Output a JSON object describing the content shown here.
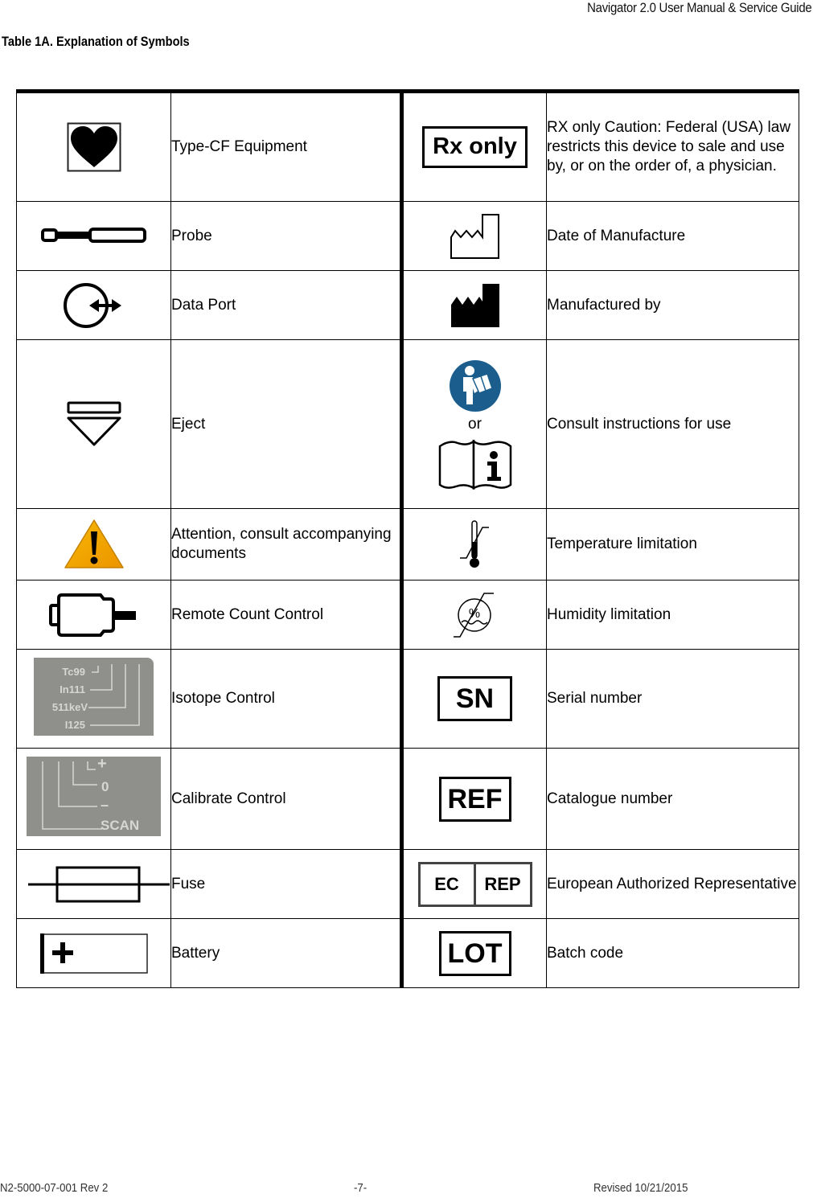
{
  "header": {
    "document_title": "Navigator 2.0 User Manual & Service Guide",
    "table_title": "Table 1A. Explanation of Symbols"
  },
  "rows": [
    {
      "left": {
        "icon": "type-cf-heart-icon",
        "label": "Type-CF Equipment"
      },
      "right": {
        "icon": "rx-only-icon",
        "icon_text": "Rx only",
        "label": "RX only Caution: Federal (USA) law restricts this device to sale and use by, or on the order of, a physician."
      }
    },
    {
      "left": {
        "icon": "probe-icon",
        "label": "Probe"
      },
      "right": {
        "icon": "date-of-manufacture-icon",
        "label": "Date of Manufacture"
      }
    },
    {
      "left": {
        "icon": "data-port-icon",
        "label": "Data Port"
      },
      "right": {
        "icon": "manufacturer-icon",
        "label": "Manufactured by"
      }
    },
    {
      "left": {
        "icon": "eject-icon",
        "label": "Eject"
      },
      "right": {
        "icon": "consult-instructions-icon",
        "or_text": "or",
        "label": "Consult instructions for use"
      }
    },
    {
      "left": {
        "icon": "warning-triangle-icon",
        "label": "Attention, consult accompanying documents"
      },
      "right": {
        "icon": "temperature-limit-icon",
        "label": "Temperature limitation"
      }
    },
    {
      "left": {
        "icon": "remote-count-control-icon",
        "label": "Remote Count Control"
      },
      "right": {
        "icon": "humidity-limit-icon",
        "label": "Humidity limitation"
      }
    },
    {
      "left": {
        "icon": "isotope-control-photo",
        "photo_labels": [
          "Tc99",
          "In111",
          "511keV",
          "I125"
        ],
        "label": "Isotope Control"
      },
      "right": {
        "icon": "serial-number-icon",
        "icon_text": "SN",
        "label": "Serial number"
      }
    },
    {
      "left": {
        "icon": "calibrate-control-photo",
        "photo_labels": [
          "+",
          "0",
          "–",
          "SCAN"
        ],
        "label": "Calibrate Control"
      },
      "right": {
        "icon": "catalogue-number-icon",
        "icon_text": "REF",
        "label": "Catalogue number"
      }
    },
    {
      "left": {
        "icon": "fuse-icon",
        "label": "Fuse"
      },
      "right": {
        "icon": "ec-rep-icon",
        "icon_text": [
          "EC",
          "REP"
        ],
        "label": "European Authorized Representative"
      }
    },
    {
      "left": {
        "icon": "battery-icon",
        "label": "Battery"
      },
      "right": {
        "icon": "batch-code-icon",
        "icon_text": "LOT",
        "label": "Batch code"
      }
    }
  ],
  "colors": {
    "ifu_blue": "#1b5e8e",
    "warning_orange": "#f2a900",
    "photo_gray": "#8f8f8c"
  },
  "footer": {
    "doc_number": "N2-5000-07-001 Rev 2",
    "page_number": "-7-",
    "revised": "Revised 10/21/2015"
  }
}
